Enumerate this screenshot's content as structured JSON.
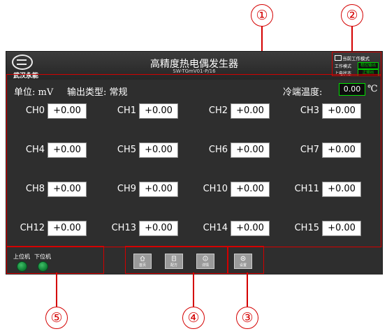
{
  "header": {
    "logo_text": "武汉永能",
    "title": "高精度热电偶发生器",
    "subtitle": "SW-TGmV01-P/16"
  },
  "mode_panel": {
    "title": "当前工作模式",
    "mode_label": "工作模式",
    "mode_value": "程控输出",
    "power_label": "上电状态",
    "power_value": "正输出"
  },
  "info": {
    "unit_label": "单位: mV",
    "output_type_label": "输出类型: 常规",
    "cold_junction_label": "冷端温度:",
    "cold_junction_value": "0.00",
    "cold_junction_unit": "℃"
  },
  "channels": [
    {
      "label": "CH0",
      "value": "+0.00"
    },
    {
      "label": "CH1",
      "value": "+0.00"
    },
    {
      "label": "CH2",
      "value": "+0.00"
    },
    {
      "label": "CH3",
      "value": "+0.00"
    },
    {
      "label": "CH4",
      "value": "+0.00"
    },
    {
      "label": "CH5",
      "value": "+0.00"
    },
    {
      "label": "CH6",
      "value": "+0.00"
    },
    {
      "label": "CH7",
      "value": "+0.00"
    },
    {
      "label": "CH8",
      "value": "+0.00"
    },
    {
      "label": "CH9",
      "value": "+0.00"
    },
    {
      "label": "CH10",
      "value": "+0.00"
    },
    {
      "label": "CH11",
      "value": "+0.00"
    },
    {
      "label": "CH12",
      "value": "+0.00"
    },
    {
      "label": "CH13",
      "value": "+0.00"
    },
    {
      "label": "CH14",
      "value": "+0.00"
    },
    {
      "label": "CH15",
      "value": "+0.00"
    }
  ],
  "footer": {
    "upper_pc_label": "上位机",
    "lower_pc_label": "下位机",
    "nav": [
      {
        "label": "首页",
        "icon": "home-icon"
      },
      {
        "label": "配方",
        "icon": "recipe-icon"
      },
      {
        "label": "详情",
        "icon": "info-icon"
      },
      {
        "label": "设置",
        "icon": "settings-icon"
      }
    ]
  },
  "callouts": [
    "①",
    "②",
    "③",
    "④",
    "⑤"
  ],
  "colors": {
    "callout": "#d40000",
    "screen_bg": "#2e2e2e",
    "led": "#1f9a4a",
    "cold_box_border": "#00e000"
  }
}
